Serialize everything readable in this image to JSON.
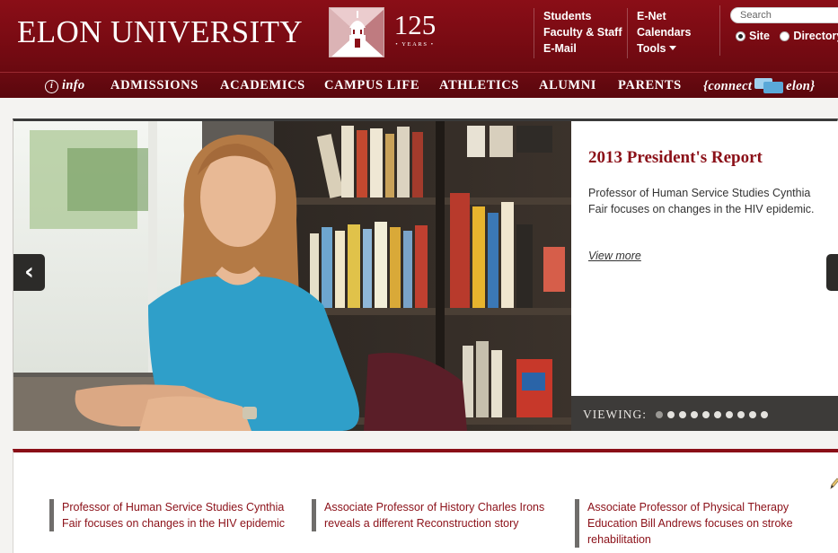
{
  "header": {
    "logo_text": "ELON UNIVERSITY",
    "anniversary_number": "125",
    "anniversary_label": "• YEARS •",
    "links_col1": [
      "Students",
      "Faculty & Staff",
      "E-Mail"
    ],
    "links_col2": [
      "E-Net",
      "Calendars",
      "Tools"
    ],
    "search_placeholder": "Search",
    "radio_site": "Site",
    "radio_directory": "Directory",
    "radio_selected": "Site"
  },
  "nav": {
    "info": "info",
    "items": [
      "ADMISSIONS",
      "ACADEMICS",
      "CAMPUS LIFE",
      "ATHLETICS",
      "ALUMNI",
      "PARENTS"
    ],
    "connect_left": "{connect",
    "connect_right": "elon}"
  },
  "slide": {
    "title": "2013 President's Report",
    "text": "Professor of Human Service Studies Cynthia Fair focuses on changes in the HIV epidemic.",
    "link": "View more",
    "viewing_label": "VIEWING:",
    "slide_count": 10,
    "active_slide": 1
  },
  "news": [
    "Professor of Human Service Studies Cynthia Fair focuses on changes in the HIV epidemic",
    "Associate Professor of History Charles Irons reveals a different Reconstruction story",
    "Associate Professor of Physical Therapy Education Bill Andrews focuses on stroke rehabilitation"
  ],
  "colors": {
    "brand_maroon": "#8a0e17",
    "nav_dark": "#5a070d",
    "link_red": "#8b1018",
    "viewing_bar": "#3d3b39"
  },
  "icons": {
    "info": "info-circle-icon",
    "connect": "chat-bubbles-icon",
    "prev": "chevron-left-icon",
    "next": "chevron-right-icon",
    "edit": "pencil-icon",
    "seal": "bell-tower-icon"
  }
}
